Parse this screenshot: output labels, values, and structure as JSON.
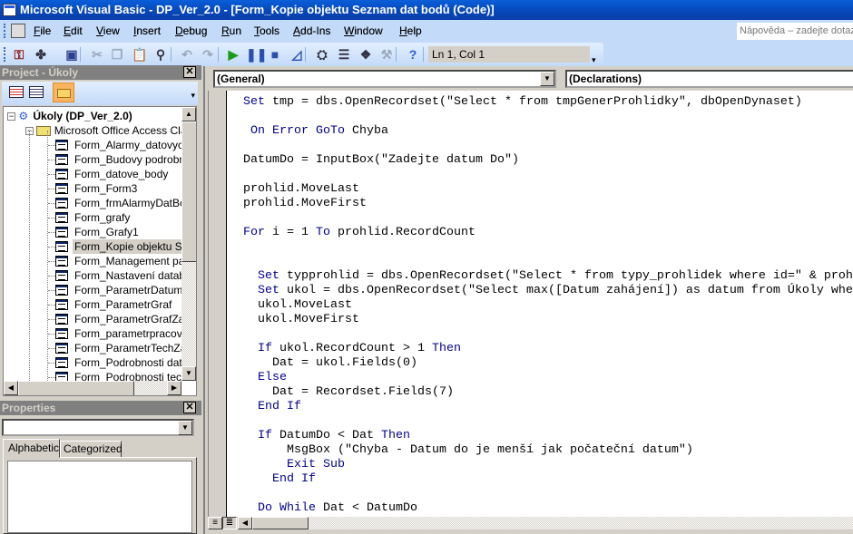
{
  "window": {
    "title": "Microsoft Visual Basic - DP_Ver_2.0 - [Form_Kopie objektu Seznam dat bodů (Code)]"
  },
  "menu": [
    {
      "label": "File",
      "u": "F",
      "rest": "ile"
    },
    {
      "label": "Edit",
      "u": "E",
      "rest": "dit"
    },
    {
      "label": "View",
      "u": "V",
      "rest": "iew"
    },
    {
      "label": "Insert",
      "u": "I",
      "rest": "nsert"
    },
    {
      "label": "Debug",
      "u": "D",
      "rest": "ebug"
    },
    {
      "label": "Run",
      "u": "R",
      "rest": "un"
    },
    {
      "label": "Tools",
      "u": "T",
      "rest": "ools"
    },
    {
      "label": "Add-Ins",
      "u": "A",
      "rest": "dd-Ins"
    },
    {
      "label": "Window",
      "u": "W",
      "rest": "indow"
    },
    {
      "label": "Help",
      "u": "H",
      "rest": "elp"
    }
  ],
  "help_box": {
    "placeholder": "Nápověda – zadejte dotaz"
  },
  "toolbar": {
    "position": "Ln 1, Col 1",
    "icons": [
      "view-access-icon",
      "insert-module-icon",
      "save-icon",
      "cut-icon",
      "copy-icon",
      "paste-icon",
      "find-icon",
      "undo-icon",
      "redo-icon",
      "run-icon",
      "break-icon",
      "reset-icon",
      "design-mode-icon",
      "project-explorer-icon",
      "properties-window-icon",
      "object-browser-icon",
      "toolbox-icon",
      "help-icon"
    ]
  },
  "project": {
    "title": "Project - Úkoly",
    "root": "Úkoly (DP_Ver_2.0)",
    "folder": "Microsoft Office Access Class",
    "items": [
      "Form_Alarmy_datovych_",
      "Form_Budovy podrobnos",
      "Form_datove_body",
      "Form_Form3",
      "Form_frmAlarmyDatBodu",
      "Form_grafy",
      "Form_Grafy1",
      "Form_Kopie objektu Sezn",
      "Form_Management  pane",
      "Form_Nastavení databáz",
      "Form_ParametrDatum",
      "Form_ParametrGraf",
      "Form_ParametrGrafZavis",
      "Form_parametrpracovnik",
      "Form_ParametrTechZar",
      "Form_Podrobnosti dat bc",
      "Form_Podrobnosti techni"
    ],
    "selected": "Form_Kopie objektu Sezn"
  },
  "properties": {
    "title": "Properties",
    "object": "",
    "tabs": [
      "Alphabetic",
      "Categorized"
    ],
    "active_tab": "Alphabetic"
  },
  "code_window": {
    "object": "(General)",
    "procedure": "(Declarations)",
    "keyword_color": "#00008b",
    "lines": [
      "Set tmp = dbs.OpenRecordset(\"Select * from tmpGenerProhlidky\", dbOpenDynaset)",
      "",
      " On Error GoTo Chyba",
      "",
      "DatumDo = InputBox(\"Zadejte datum Do\")",
      "",
      "prohlid.MoveLast",
      "prohlid.MoveFirst",
      "",
      "For i = 1 To prohlid.RecordCount",
      "",
      "",
      "  Set typprohlid = dbs.OpenRecordset(\"Select * from typy_prohlidek where id=\" & proh",
      "  Set ukol = dbs.OpenRecordset(\"Select max([Datum zahájení]) as datum from Úkoly whe",
      "  ukol.MoveLast",
      "  ukol.MoveFirst",
      "",
      "  If ukol.RecordCount > 1 Then",
      "    Dat = ukol.Fields(0)",
      "  Else",
      "    Dat = Recordset.Fields(7)",
      "  End If",
      "",
      "  If DatumDo < Dat Then",
      "      MsgBox (\"Chyba - Datum do je menší jak počateční datum\")",
      "      Exit Sub",
      "    End If",
      "",
      "  Do While Dat < DatumDo"
    ]
  }
}
